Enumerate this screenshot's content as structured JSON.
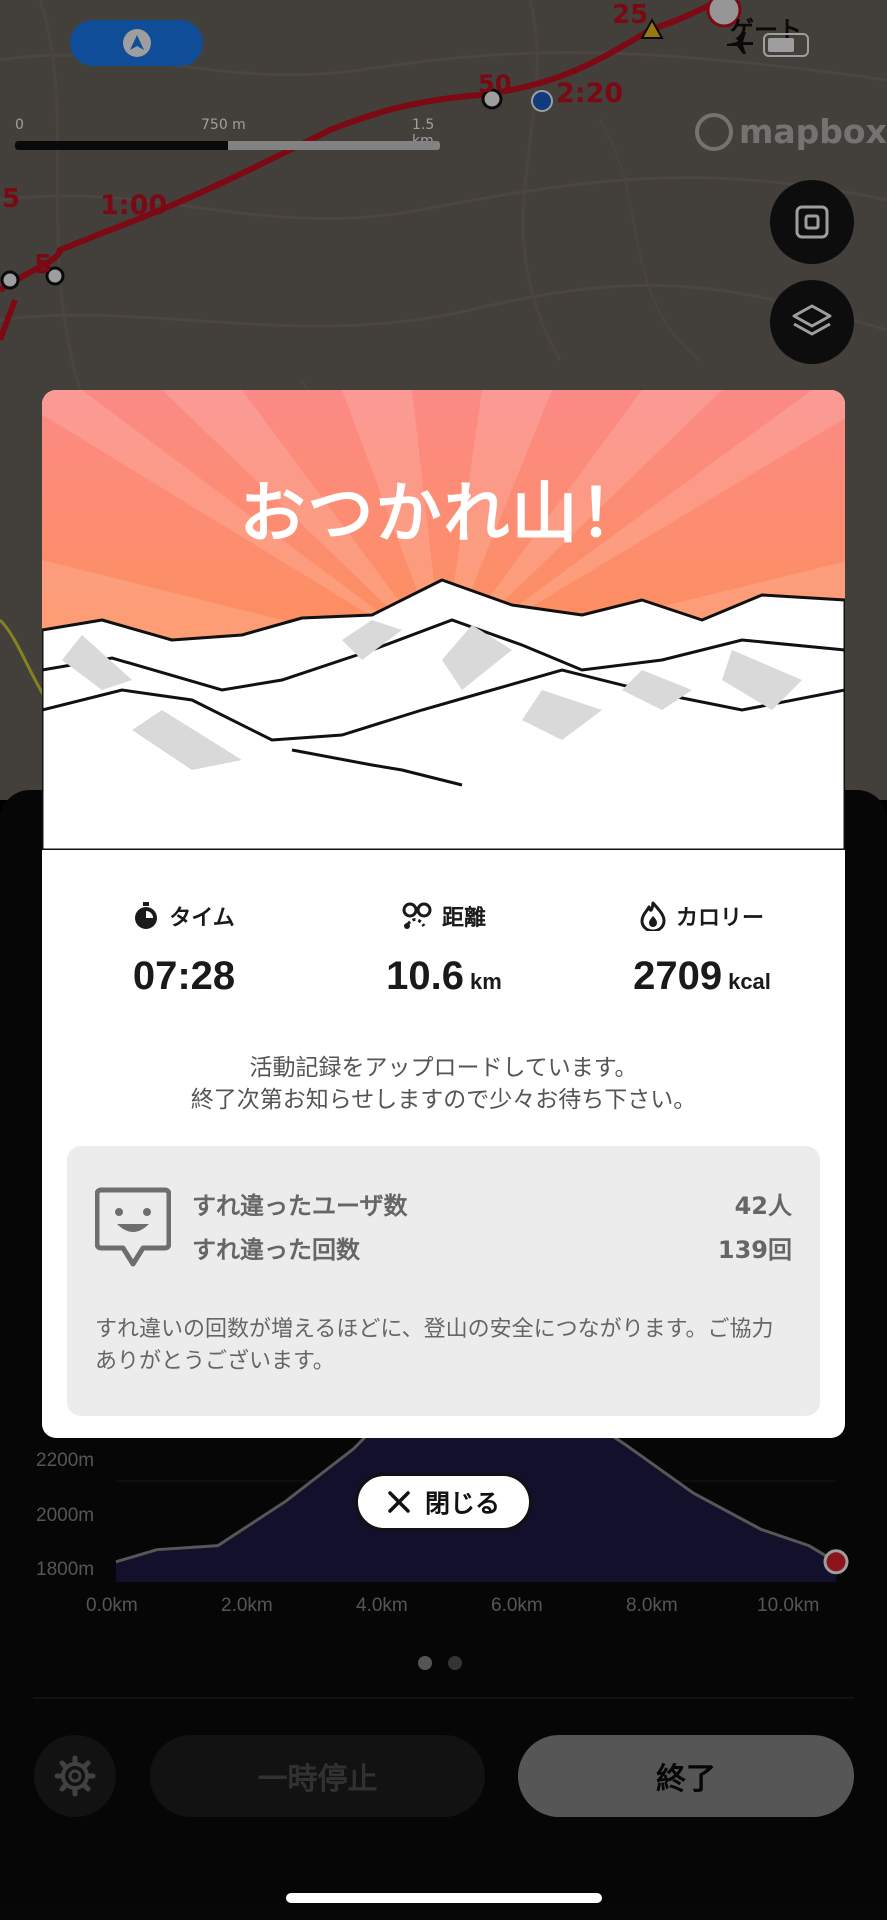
{
  "map": {
    "scale": {
      "start": "0",
      "mid": "750 m",
      "end": "1.5 km"
    },
    "attribution": "mapbox",
    "labels": [
      "25",
      "50",
      "2:20",
      "1:00",
      "5",
      "5",
      "ゲート"
    ],
    "buttons": [
      "fit-bounds",
      "layers"
    ]
  },
  "modal": {
    "title": "おつかれ山！",
    "stats": {
      "time": {
        "label": "タイム",
        "value": "07:28",
        "unit": ""
      },
      "distance": {
        "label": "距離",
        "value": "10.6",
        "unit": "km"
      },
      "calories": {
        "label": "カロリー",
        "value": "2709",
        "unit": "kcal"
      }
    },
    "upload_message_line1": "活動記録をアップロードしています。",
    "upload_message_line2": "終了次第お知らせしますので少々お待ち下さい。",
    "passing": {
      "users_label": "すれ違ったユーザ数",
      "users_value": "42人",
      "count_label": "すれ違った回数",
      "count_value": "139回",
      "note": "すれ違いの回数が増えるほどに、登山の安全につながります。ご協力ありがとうございます。"
    },
    "close_label": "閉じる"
  },
  "chart_data": {
    "type": "area",
    "title": "",
    "xlabel": "",
    "ylabel": "",
    "y_ticks": [
      "2200m",
      "2000m",
      "1800m"
    ],
    "x_ticks": [
      "0.0km",
      "2.0km",
      "4.0km",
      "6.0km",
      "8.0km",
      "10.0km"
    ],
    "x": [
      0.0,
      0.6,
      1.5,
      2.5,
      3.5,
      4.2,
      6.5,
      7.5,
      8.5,
      9.5,
      10.2,
      10.6
    ],
    "y": [
      1800,
      1830,
      1840,
      1950,
      2080,
      2200,
      2200,
      2090,
      1970,
      1880,
      1840,
      1800
    ],
    "ylim": [
      1750,
      2250
    ],
    "color": "#1e1b45",
    "end_marker_color": "#e01f2c"
  },
  "bottom": {
    "pause_label": "一時停止",
    "end_label": "終了"
  }
}
